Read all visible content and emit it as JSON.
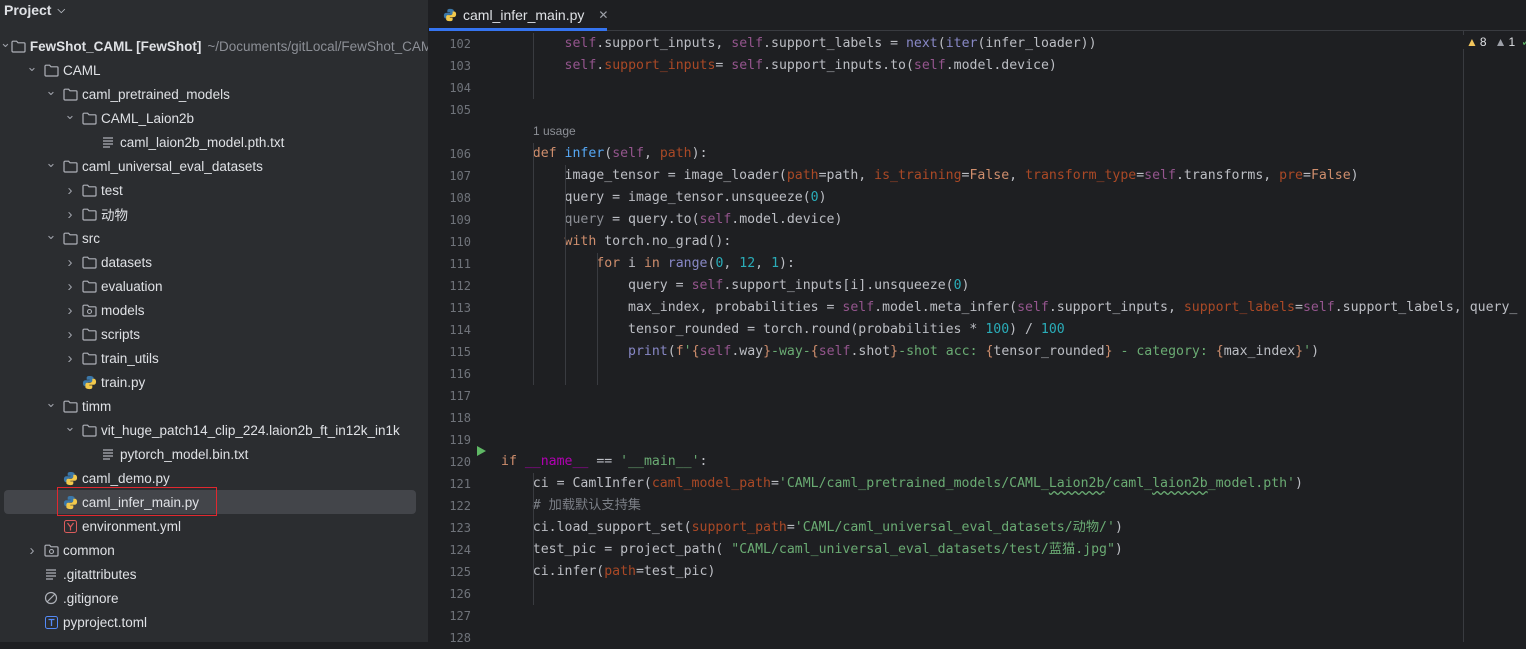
{
  "sidebar": {
    "title": "Project",
    "tree": [
      {
        "label": "FewShot_CAML [FewShot]",
        "extra": "~/Documents/gitLocal/FewShot_CAML",
        "indent": 0,
        "arrow": "down",
        "icon": "folder",
        "bold": true
      },
      {
        "label": "CAML",
        "indent": 1,
        "arrow": "down",
        "icon": "folder"
      },
      {
        "label": "caml_pretrained_models",
        "indent": 2,
        "arrow": "down",
        "icon": "folder"
      },
      {
        "label": "CAML_Laion2b",
        "indent": 3,
        "arrow": "down",
        "icon": "folder"
      },
      {
        "label": "caml_laion2b_model.pth.txt",
        "indent": 4,
        "arrow": "none",
        "icon": "text"
      },
      {
        "label": "caml_universal_eval_datasets",
        "indent": 2,
        "arrow": "down",
        "icon": "folder"
      },
      {
        "label": "test",
        "indent": 3,
        "arrow": "right",
        "icon": "folder"
      },
      {
        "label": "动物",
        "indent": 3,
        "arrow": "right",
        "icon": "folder"
      },
      {
        "label": "src",
        "indent": 2,
        "arrow": "down",
        "icon": "folder"
      },
      {
        "label": "datasets",
        "indent": 3,
        "arrow": "right",
        "icon": "folder"
      },
      {
        "label": "evaluation",
        "indent": 3,
        "arrow": "right",
        "icon": "folder"
      },
      {
        "label": "models",
        "indent": 3,
        "arrow": "right",
        "icon": "package"
      },
      {
        "label": "scripts",
        "indent": 3,
        "arrow": "right",
        "icon": "folder"
      },
      {
        "label": "train_utils",
        "indent": 3,
        "arrow": "right",
        "icon": "folder"
      },
      {
        "label": "train.py",
        "indent": 3,
        "arrow": "none",
        "icon": "python"
      },
      {
        "label": "timm",
        "indent": 2,
        "arrow": "down",
        "icon": "folder"
      },
      {
        "label": "vit_huge_patch14_clip_224.laion2b_ft_in12k_in1k",
        "indent": 3,
        "arrow": "down",
        "icon": "folder"
      },
      {
        "label": "pytorch_model.bin.txt",
        "indent": 4,
        "arrow": "none",
        "icon": "text"
      },
      {
        "label": "caml_demo.py",
        "indent": 2,
        "arrow": "none",
        "icon": "python"
      },
      {
        "label": "caml_infer_main.py",
        "indent": 2,
        "arrow": "none",
        "icon": "python",
        "selected": true
      },
      {
        "label": "environment.yml",
        "indent": 2,
        "arrow": "none",
        "icon": "yaml"
      },
      {
        "label": "common",
        "indent": 1,
        "arrow": "right",
        "icon": "package"
      },
      {
        "label": ".gitattributes",
        "indent": 1,
        "arrow": "none",
        "icon": "text"
      },
      {
        "label": ".gitignore",
        "indent": 1,
        "arrow": "none",
        "icon": "ignore"
      },
      {
        "label": "pyproject.toml",
        "indent": 1,
        "arrow": "none",
        "icon": "toml"
      }
    ]
  },
  "editor": {
    "tab": {
      "label": "caml_infer_main.py",
      "close": "✕"
    },
    "inspections": {
      "warnings": "8",
      "weak": "1"
    },
    "usage_hint": "1 usage",
    "lines": [
      {
        "n": "102",
        "text": "        self.support_inputs, self.support_labels = next(iter(infer_loader))"
      },
      {
        "n": "103",
        "text": "        self.support_inputs= self.support_inputs.to(self.model.device)"
      },
      {
        "n": "104",
        "text": ""
      },
      {
        "n": "105",
        "text": ""
      },
      {
        "n": "106",
        "text": "    def infer(self, path):"
      },
      {
        "n": "107",
        "text": "        image_tensor = image_loader(path=path, is_training=False, transform_type=self.transforms, pre=False)"
      },
      {
        "n": "108",
        "text": "        query = image_tensor.unsqueeze(0)"
      },
      {
        "n": "109",
        "text": "        query = query.to(self.model.device)"
      },
      {
        "n": "110",
        "text": "        with torch.no_grad():"
      },
      {
        "n": "111",
        "text": "            for i in range(0, 12, 1):"
      },
      {
        "n": "112",
        "text": "                query = self.support_inputs[i].unsqueeze(0)"
      },
      {
        "n": "113",
        "text": "                max_index, probabilities = self.model.meta_infer(self.support_inputs, support_labels=self.support_labels, query_"
      },
      {
        "n": "114",
        "text": "                tensor_rounded = torch.round(probabilities * 100) / 100"
      },
      {
        "n": "115",
        "text": "                print(f'{self.way}-way-{self.shot}-shot acc: {tensor_rounded} - category: {max_index}')"
      },
      {
        "n": "116",
        "text": ""
      },
      {
        "n": "117",
        "text": ""
      },
      {
        "n": "118",
        "text": ""
      },
      {
        "n": "119",
        "text": ""
      },
      {
        "n": "120",
        "text": "if __name__ == '__main__':"
      },
      {
        "n": "121",
        "text": "    ci = CamlInfer(caml_model_path='CAML/caml_pretrained_models/CAML_Laion2b/caml_laion2b_model.pth')"
      },
      {
        "n": "122",
        "text": "    # 加载默认支持集"
      },
      {
        "n": "123",
        "text": "    ci.load_support_set(support_path='CAML/caml_universal_eval_datasets/动物/')"
      },
      {
        "n": "124",
        "text": "    test_pic = project_path( \"CAML/caml_universal_eval_datasets/test/蓝猫.jpg\")"
      },
      {
        "n": "125",
        "text": "    ci.infer(path=test_pic)"
      },
      {
        "n": "126",
        "text": ""
      },
      {
        "n": "127",
        "text": ""
      },
      {
        "n": "128",
        "text": ""
      }
    ]
  },
  "colors": {
    "accent": "#3574f0",
    "selection_box": "#e0282f",
    "folder": "#9da0a8",
    "python_blue": "#3b77a8",
    "python_yellow": "#f2c94c"
  }
}
